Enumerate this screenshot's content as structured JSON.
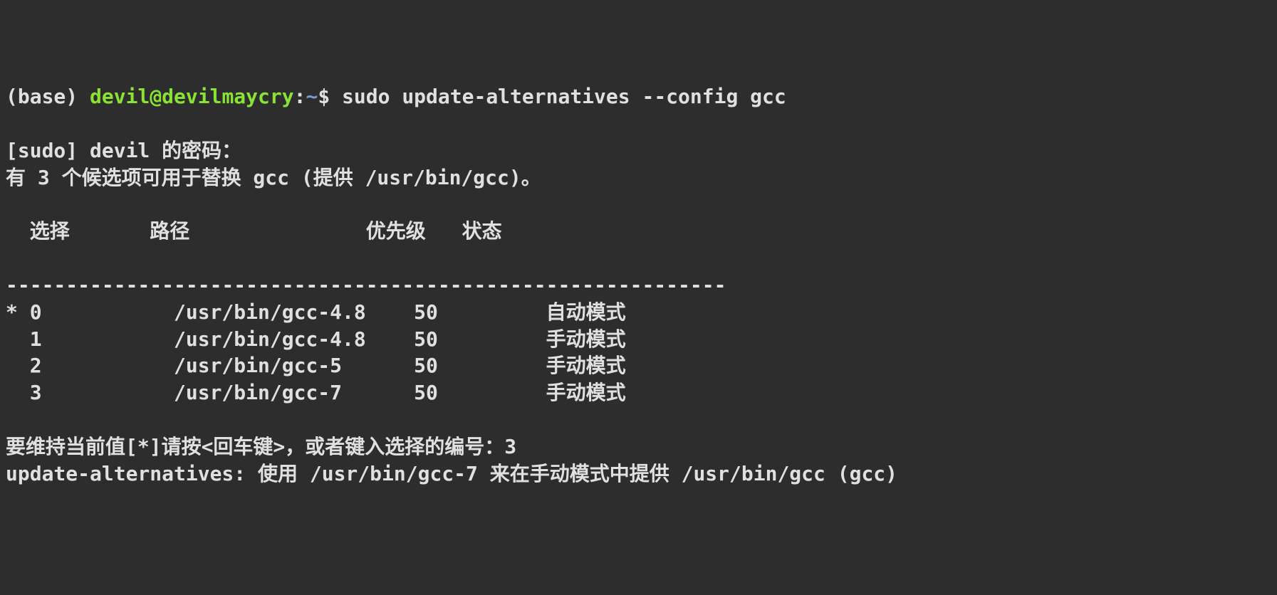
{
  "prompt": {
    "env": "(base) ",
    "user_host": "devil@devilmaycry",
    "colon": ":",
    "path": "~",
    "dollar": "$ ",
    "command": "sudo update-alternatives --config gcc"
  },
  "sudo_prompt": "[sudo] devil 的密码：",
  "summary": "有 3 个候选项可用于替换 gcc (提供 /usr/bin/gcc)。",
  "headers": {
    "selection": "选择",
    "path": "路径",
    "priority": "优先级",
    "status": "状态"
  },
  "separator": "------------------------------------------------------------",
  "rows": [
    {
      "mark": "*",
      "num": "0",
      "path": "/usr/bin/gcc-4.8",
      "priority": "50",
      "status": "自动模式"
    },
    {
      "mark": " ",
      "num": "1",
      "path": "/usr/bin/gcc-4.8",
      "priority": "50",
      "status": "手动模式"
    },
    {
      "mark": " ",
      "num": "2",
      "path": "/usr/bin/gcc-5",
      "priority": "50",
      "status": "手动模式"
    },
    {
      "mark": " ",
      "num": "3",
      "path": "/usr/bin/gcc-7",
      "priority": "50",
      "status": "手动模式"
    }
  ],
  "input_prompt": "要维持当前值[*]请按<回车键>，或者键入选择的编号：",
  "user_input": "3",
  "result": "update-alternatives: 使用 /usr/bin/gcc-7 来在手动模式中提供 /usr/bin/gcc (gcc)"
}
